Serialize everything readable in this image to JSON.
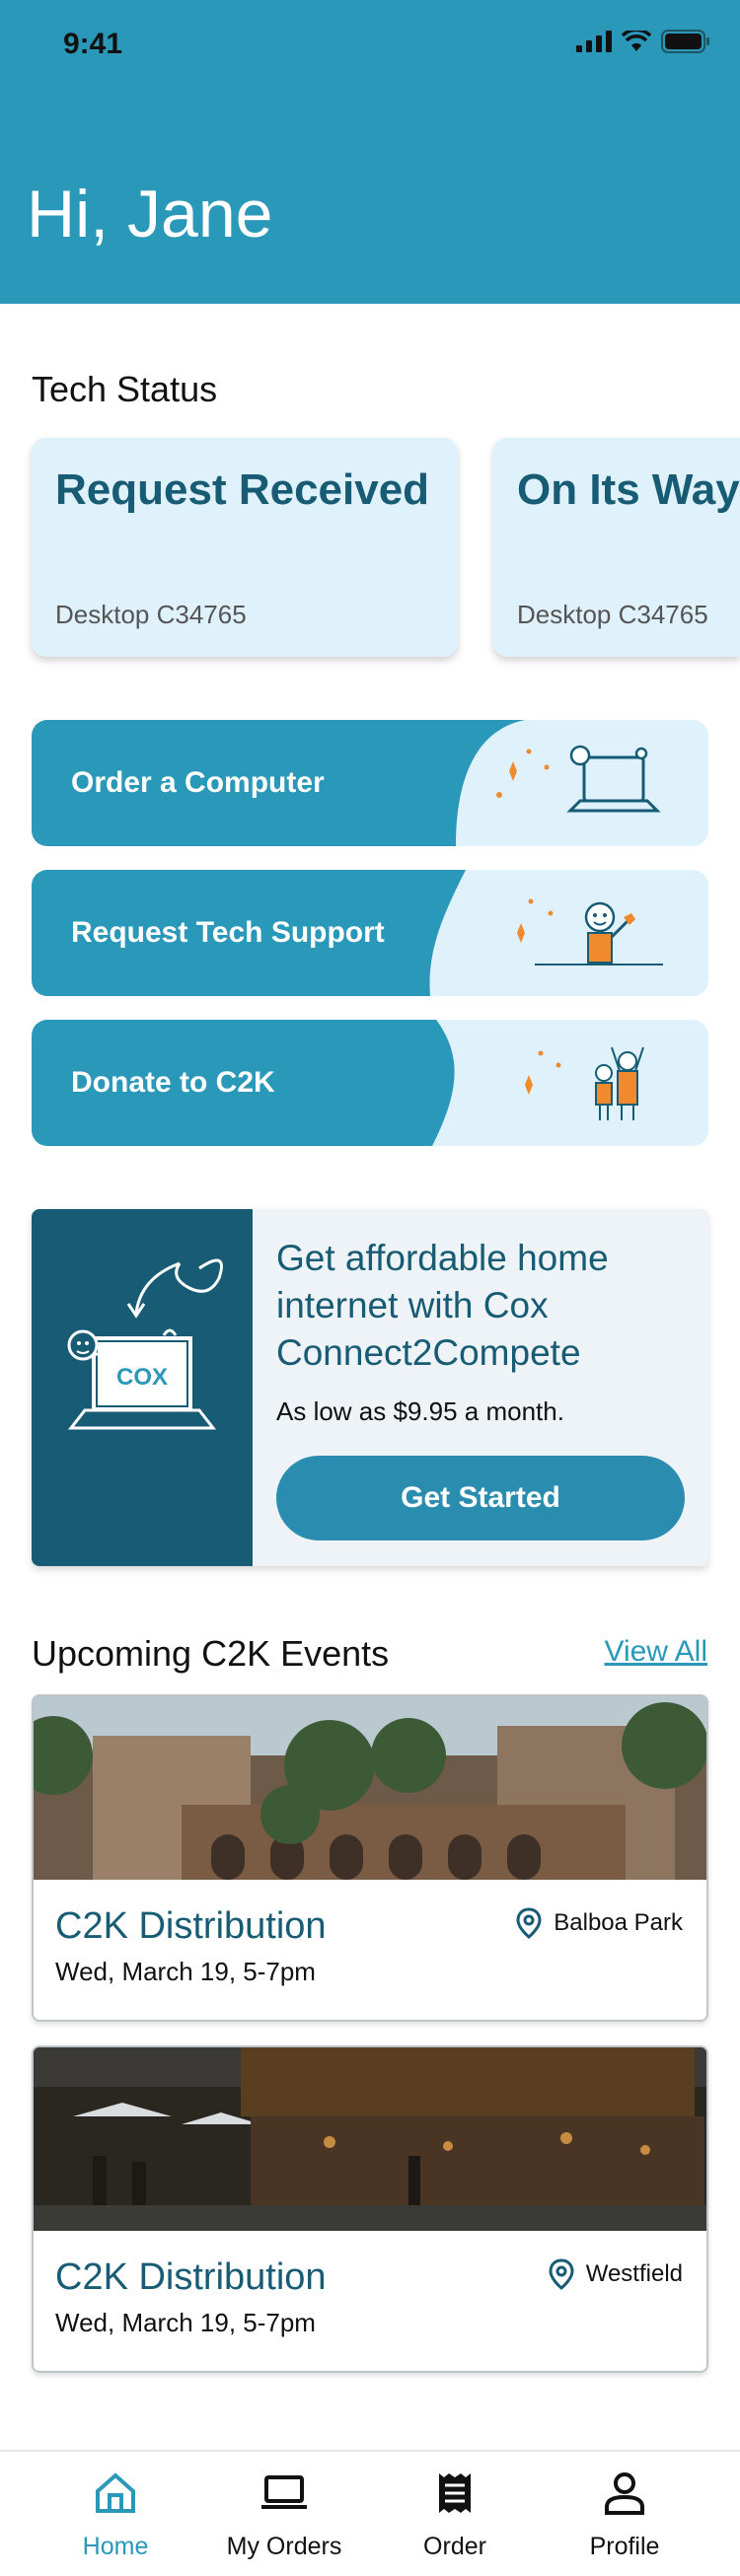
{
  "status_bar": {
    "time": "9:41"
  },
  "header": {
    "greeting": "Hi, Jane"
  },
  "tech_status": {
    "title": "Tech Status",
    "cards": [
      {
        "title": "Request Received",
        "subtitle": "Desktop C34765"
      },
      {
        "title": "On Its Way",
        "subtitle": "Desktop C34765"
      }
    ]
  },
  "actions": [
    {
      "label": "Order a Computer",
      "icon": "computer-illustration"
    },
    {
      "label": "Request Tech Support",
      "icon": "tech-support-illustration"
    },
    {
      "label": "Donate to C2K",
      "icon": "donate-illustration"
    }
  ],
  "promo": {
    "heading": "Get affordable home internet with Cox Connect2Compete",
    "subtext": "As low as $9.95 a month.",
    "button_label": "Get Started",
    "logo_text": "COX"
  },
  "events": {
    "title": "Upcoming C2K Events",
    "view_all": "View All",
    "items": [
      {
        "name": "C2K Distribution",
        "date": "Wed, March 19, 5-7pm",
        "location": "Balboa Park"
      },
      {
        "name": "C2K Distribution",
        "date": "Wed, March 19, 5-7pm",
        "location": "Westfield"
      }
    ]
  },
  "tabbar": {
    "items": [
      {
        "label": "Home",
        "icon": "home-icon",
        "active": true
      },
      {
        "label": "My Orders",
        "icon": "laptop-icon",
        "active": false
      },
      {
        "label": "Order",
        "icon": "receipt-icon",
        "active": false
      },
      {
        "label": "Profile",
        "icon": "person-icon",
        "active": false
      }
    ]
  },
  "colors": {
    "primary": "#2a98b8",
    "dark": "#175c74",
    "light": "#dff1fb",
    "accent": "#f08a2c"
  }
}
